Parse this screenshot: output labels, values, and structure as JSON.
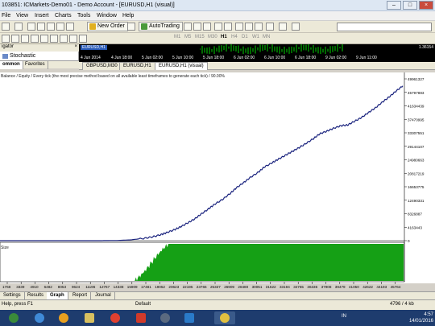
{
  "window": {
    "title": "103851: ICMarkets-Demo01 - Demo Account - [EURUSD,H1 (visual)]"
  },
  "menu": [
    "File",
    "View",
    "Insert",
    "Charts",
    "Tools",
    "Window",
    "Help"
  ],
  "toolbar": {
    "new_order": "New Order",
    "autotrading": "AutoTrading",
    "timeframes": [
      "M1",
      "M5",
      "M15",
      "M30",
      "H1",
      "H4",
      "D1",
      "W1",
      "MN"
    ]
  },
  "navigator": {
    "title": "igator",
    "item": "Stochastic",
    "tabs": [
      "ommon",
      "Favorites"
    ]
  },
  "minichart": {
    "symbol": "EURUSD,H1",
    "price": "1.36154",
    "dates": [
      "4 Jun 2014",
      "4 Jun 18:00",
      "5 Jun 02:00",
      "5 Jun 10:00",
      "5 Jun 18:00",
      "6 Jun 02:00",
      "6 Jun 10:00",
      "6 Jun 18:00",
      "9 Jun 02:00",
      "9 Jun 11:00"
    ]
  },
  "chart_tabs": [
    "GBPUSD,M30",
    "EURUSD,H1",
    "EURUSD,H1 (visual)"
  ],
  "chart_header": "Balance / Equity / Every tick (the most precise method based on all available least timeframes to generate each tick) / 90.00%",
  "volume_label": "Size",
  "chart_data": {
    "type": "line",
    "series": [
      {
        "name": "Balance / Equity"
      }
    ],
    "y_ticks": [
      "49961327",
      "45797883",
      "41634439",
      "37470995",
      "33307551",
      "29144107",
      "24980663",
      "20817219",
      "16653775",
      "12490331",
      "8326887",
      "4163443",
      "0"
    ],
    "ylim": [
      0,
      49961327
    ],
    "x_ticks": [
      "1768",
      "3339",
      "4910",
      "6482",
      "8053",
      "9624",
      "11196",
      "12767",
      "14338",
      "15909",
      "17481",
      "19052",
      "20623",
      "22195",
      "23766",
      "25337",
      "26909",
      "28480",
      "30051",
      "31622",
      "33194",
      "34765",
      "36336",
      "37908",
      "39479",
      "41050",
      "42622",
      "44193",
      "45764"
    ],
    "xlim": [
      1768,
      47300
    ],
    "x": [
      1768,
      10000,
      13000,
      15000,
      16500,
      18000,
      19052,
      20000,
      20623,
      21500,
      22195,
      23000,
      23766,
      24500,
      25337,
      26000,
      26909,
      27800,
      28480,
      29300,
      30051,
      31000,
      31622,
      32500,
      33194,
      34000,
      34765,
      35500,
      36336,
      37200,
      37908,
      38700,
      39479,
      40300,
      41050,
      41800,
      42622,
      43400,
      44193,
      45000,
      45764,
      46500,
      47300
    ],
    "y": [
      0,
      0,
      0,
      60000,
      250000,
      700000,
      1200000,
      1900000,
      2500000,
      3400000,
      4300000,
      5500000,
      6700000,
      8200000,
      9800000,
      11200000,
      12700000,
      14600000,
      16300000,
      17900000,
      19500000,
      21200000,
      22700000,
      24000000,
      25100000,
      26300000,
      27500000,
      28600000,
      30000000,
      31500000,
      33000000,
      33800000,
      34700000,
      35500000,
      35700000,
      36800000,
      38000000,
      39500000,
      41000000,
      42800000,
      44400000,
      46100000,
      47800000
    ]
  },
  "volume": {
    "start_x": 17000,
    "ramp_end_x": 20800
  },
  "bottom_tabs": [
    "Settings",
    "Results",
    "Graph",
    "Report",
    "Journal"
  ],
  "status": {
    "help": "Help, press F1",
    "profile": "Default",
    "traffic": "4796 / 4 kb"
  },
  "taskbar": {
    "lang": "IN",
    "time": "4:57",
    "date": "14/01/2016"
  },
  "colors": {
    "equity_line": "#1a237e",
    "volume_fill": "#15a015",
    "chart_bg": "#ffffff"
  }
}
